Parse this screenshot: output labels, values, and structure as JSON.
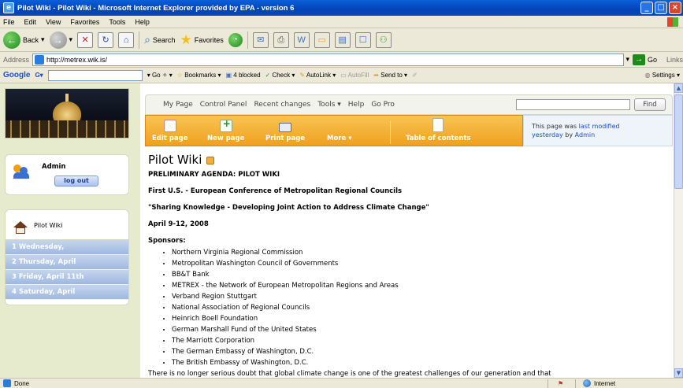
{
  "window": {
    "title": "Pilot Wiki - Pilot Wiki - Microsoft Internet Explorer provided by EPA - version 6"
  },
  "menu": [
    "File",
    "Edit",
    "View",
    "Favorites",
    "Tools",
    "Help"
  ],
  "toolbar": {
    "back": "Back",
    "search": "Search",
    "favorites": "Favorites"
  },
  "address": {
    "label": "Address",
    "url": "http://metrex.wik.is/",
    "go": "Go",
    "links": "Links"
  },
  "google_bar": {
    "logo": "Google",
    "go": "Go",
    "bookmarks": "Bookmarks",
    "blocked": "4 blocked",
    "check": "Check",
    "autolink": "AutoLink",
    "autofill": "AutoFill",
    "sendto": "Send to",
    "settings": "Settings"
  },
  "user": {
    "name": "Admin",
    "logout": "log out"
  },
  "nav": {
    "home": "Pilot Wiki",
    "items": [
      "1 Wednesday,",
      "2 Thursday, April",
      "3 Friday, April 11th",
      "4 Saturday, April"
    ]
  },
  "topnav": {
    "links": [
      "My Page",
      "Control Panel",
      "Recent changes",
      "Tools ▾",
      "Help",
      "Go Pro"
    ],
    "find": "Find"
  },
  "actions": {
    "edit": "Edit page",
    "new": "New page",
    "print": "Print page",
    "more": "More ▾",
    "toc": "Table of contents"
  },
  "modified": {
    "prefix": "This page was",
    "link1": "last modified",
    "link2": "yesterday",
    "by": "by",
    "user": "Admin"
  },
  "page": {
    "title": "Pilot Wiki",
    "heading1": "PRELIMINARY AGENDA: PILOT WIKI",
    "heading2": "First U.S. - European Conference of Metropolitan Regional Councils",
    "heading3": "\"Sharing Knowledge - Developing Joint Action to Address Climate Change\"",
    "dates": "April 9-12, 2008",
    "sponsors_label": "Sponsors:",
    "sponsors": [
      "Northern Virginia Regional Commission",
      "Metropolitan Washington Council of Governments",
      "BB&T Bank",
      "METREX - the Network of European Metropolitan Regions and Areas",
      "Verband Region Stuttgart",
      "National Association of Regional Councils",
      "Heinrich Boell Foundation",
      "German Marshall Fund of the United States",
      "The Marriott Corporation",
      "The German Embassy of Washington, D.C.",
      "The British Embassy of Washington, D.C."
    ],
    "intro": "There is no longer serious doubt that global climate change is one of the greatest challenges of our generation and that"
  },
  "status": {
    "left": "Done",
    "zone": "Internet"
  }
}
